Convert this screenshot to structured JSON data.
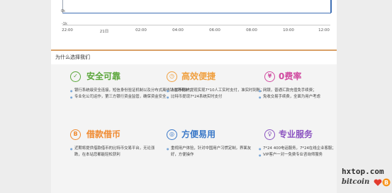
{
  "chart": {
    "y_labels": [
      "0k",
      "-1k"
    ],
    "x_ticks": [
      "22:00",
      "21日",
      "02:00",
      "04:00",
      "06:00",
      "08:00",
      "10:00",
      "12:00"
    ]
  },
  "section": {
    "heading": "为什么选择我们"
  },
  "features": [
    {
      "title": "安全可靠",
      "color": "#5aa63a",
      "icon": "shield-icon",
      "glyph": "✓",
      "items": [
        "银行系统级安全连接，短信身份验证机制以及分布式离线钱包等机制；",
        "专业化公司运作，第三方银行资金监管，确保资金安全"
      ]
    },
    {
      "title": "高效便捷",
      "color": "#f0a040",
      "icon": "clock-icon",
      "glyph": "◷",
      "items": [
        "人民币账户提现实现7*10人工实时支付，准实时到账；",
        "比特币提现7*24系统实时支付"
      ]
    },
    {
      "title": "0费率",
      "color": "#d04aa0",
      "icon": "coin-icon",
      "glyph": "¥",
      "items": [
        "网银，普通汇款充值免手续费；",
        "免收交易手续费，全面为用户考虑"
      ]
    },
    {
      "title": "借款借币",
      "color": "#f08a30",
      "icon": "bitcoin-icon",
      "glyph": "B",
      "items": [
        "近期将提供借款借币的比特币交易平台，无论涨跌，在本站您都能轻松获利"
      ]
    },
    {
      "title": "方便易用",
      "color": "#3a78c8",
      "icon": "compass-icon",
      "glyph": "◎",
      "items": [
        "重视用户体验，针对中国用户习惯定制，界面友好，方便操作"
      ]
    },
    {
      "title": "专业服务",
      "color": "#8a52c0",
      "icon": "support-icon",
      "glyph": "♀",
      "items": [
        "7*24 400电话服务，7*24在线企业客服；",
        "VIP客户一对一免费专业咨询师服务"
      ]
    }
  ],
  "watermark": {
    "site": "hxtop.com",
    "sub": "bitcoin"
  }
}
